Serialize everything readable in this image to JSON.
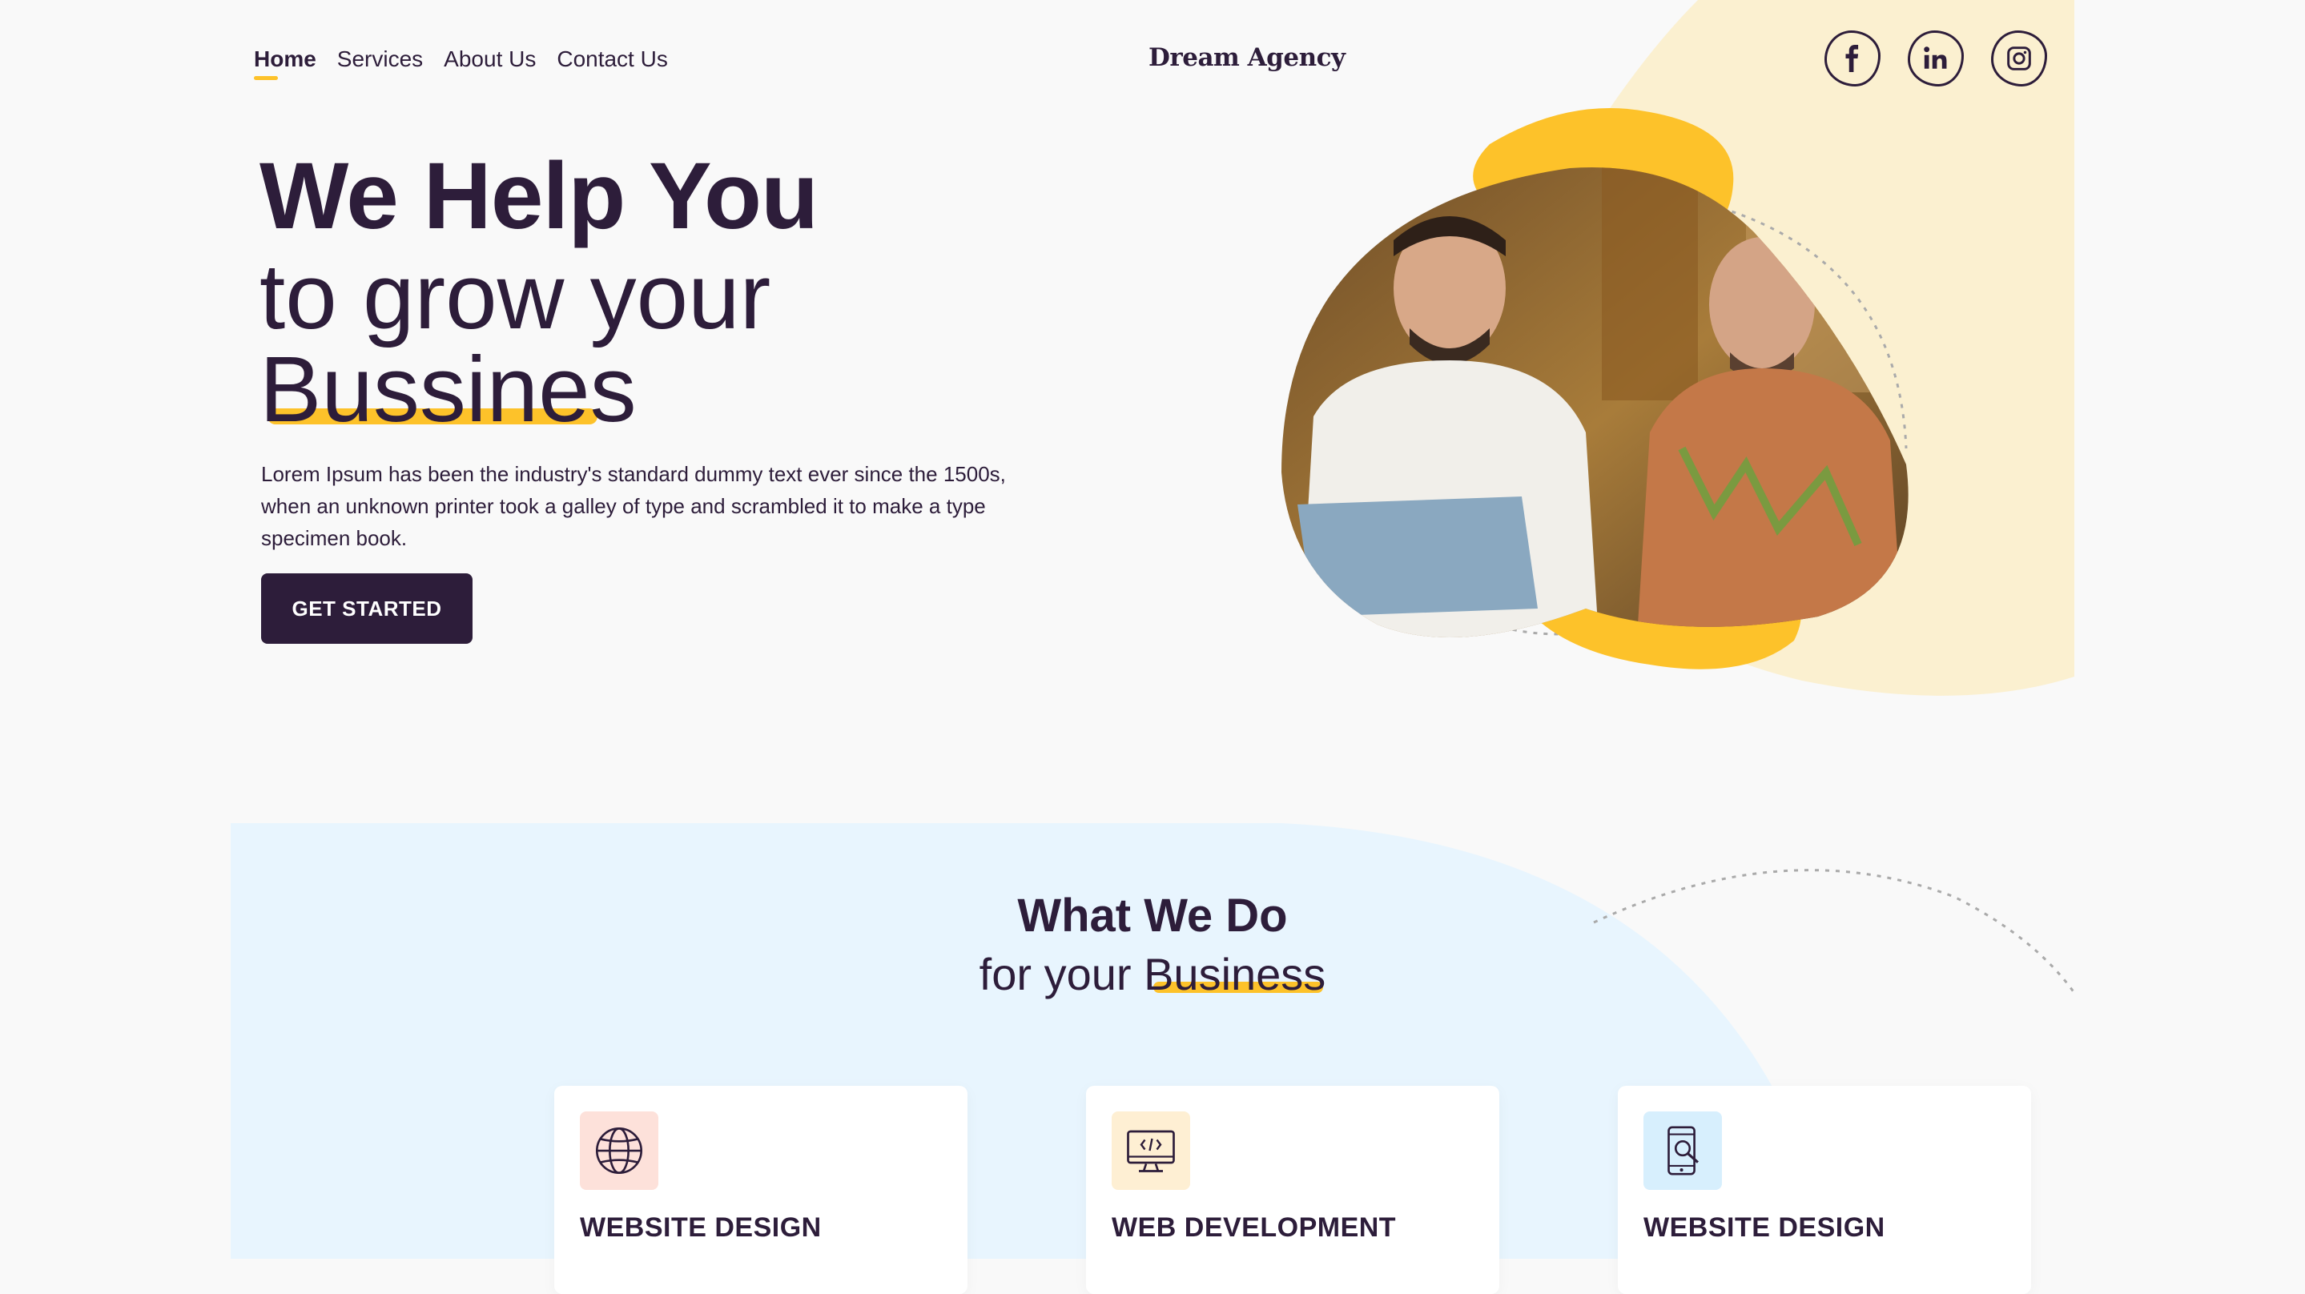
{
  "nav": {
    "items": [
      {
        "label": "Home",
        "active": true
      },
      {
        "label": "Services",
        "active": false
      },
      {
        "label": "About Us",
        "active": false
      },
      {
        "label": "Contact Us",
        "active": false
      }
    ],
    "brand": "Dream Agency",
    "social": [
      "facebook-icon",
      "linkedin-icon",
      "instagram-icon"
    ]
  },
  "hero": {
    "line1": "We Help You",
    "line2": "to grow your",
    "line3": "Bussines",
    "paragraph": "Lorem Ipsum has been the industry's standard dummy text ever since the 1500s, when an unknown printer took a galley of type and scrambled it to make a type specimen book.",
    "cta": "GET STARTED",
    "image_alt": "two-men-with-laptop"
  },
  "services": {
    "title": "What We Do",
    "subtitle_prefix": "for your ",
    "subtitle_highlight": "Business",
    "cards": [
      {
        "title": "WEBSITE DESIGN",
        "icon": "globe-icon",
        "color": "#fde1da"
      },
      {
        "title": "WEB DEVELOPMENT",
        "icon": "monitor-code-icon",
        "color": "#feefd3"
      },
      {
        "title": "WEBSITE DESIGN",
        "icon": "mobile-search-icon",
        "color": "#d7effd"
      }
    ]
  },
  "colors": {
    "primary": "#2d1d3a",
    "accent": "#fdc22a",
    "light_yellow": "#fbf0d0",
    "light_blue": "#e8f5fe"
  }
}
